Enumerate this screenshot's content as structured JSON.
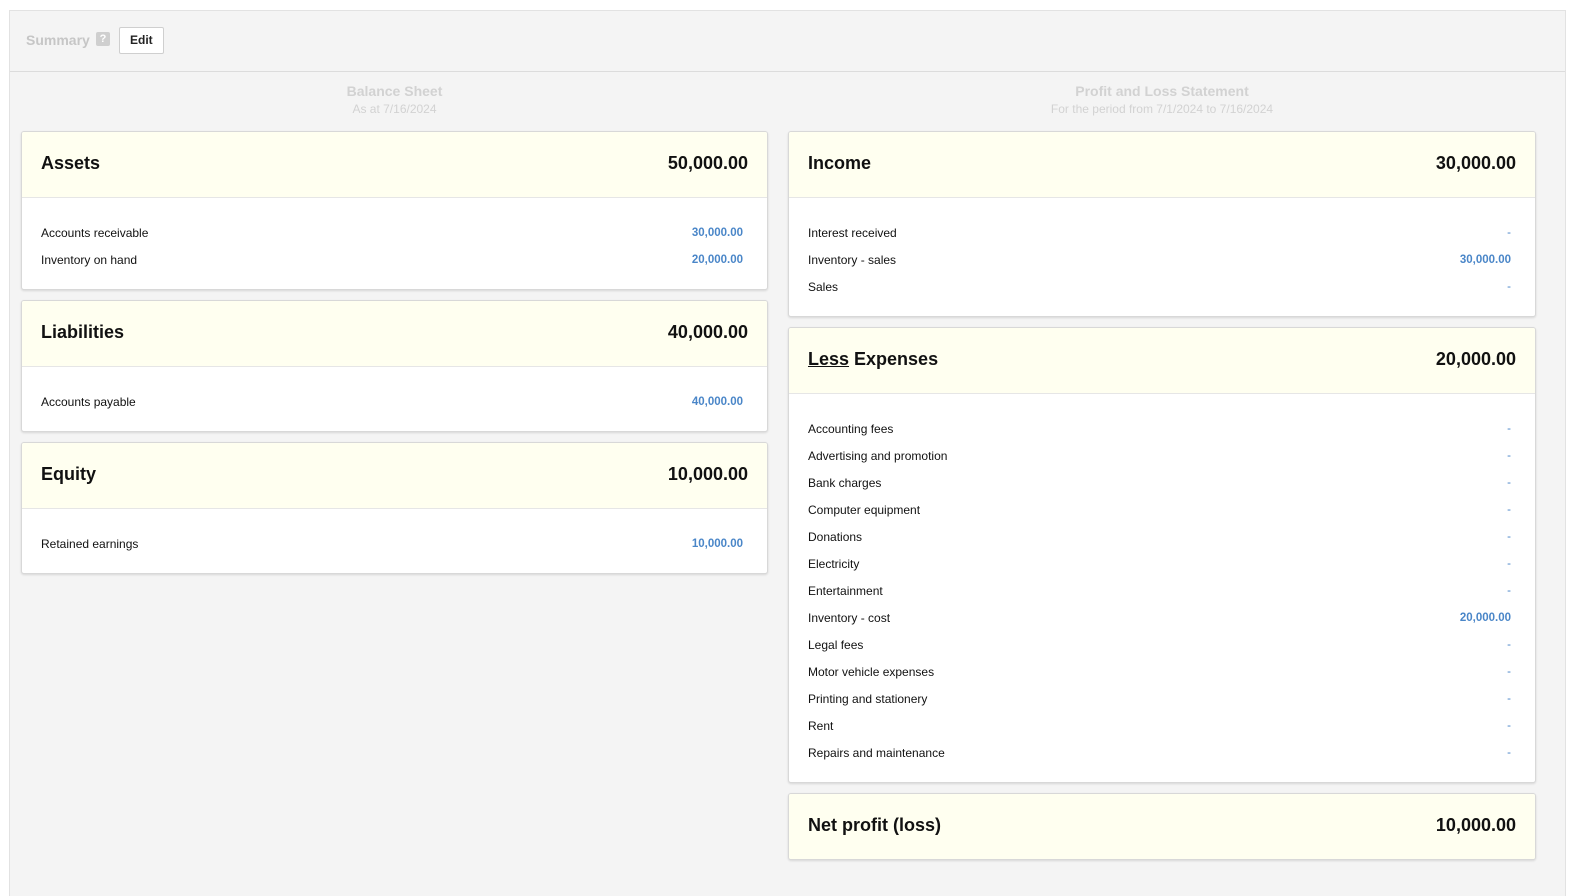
{
  "header": {
    "title": "Summary",
    "help_glyph": "?",
    "edit_label": "Edit"
  },
  "balance_sheet": {
    "title": "Balance Sheet",
    "subtitle": "As at 7/16/2024",
    "sections": [
      {
        "title": "Assets",
        "total": "50,000.00",
        "rows": [
          {
            "label": "Accounts receivable",
            "value": "30,000.00"
          },
          {
            "label": "Inventory on hand",
            "value": "20,000.00"
          }
        ]
      },
      {
        "title": "Liabilities",
        "total": "40,000.00",
        "rows": [
          {
            "label": "Accounts payable",
            "value": "40,000.00"
          }
        ]
      },
      {
        "title": "Equity",
        "total": "10,000.00",
        "rows": [
          {
            "label": "Retained earnings",
            "value": "10,000.00"
          }
        ]
      }
    ]
  },
  "profit_loss": {
    "title": "Profit and Loss Statement",
    "subtitle": "For the period from 7/1/2024 to 7/16/2024",
    "income": {
      "title": "Income",
      "total": "30,000.00",
      "rows": [
        {
          "label": "Interest received",
          "value": "-"
        },
        {
          "label": "Inventory - sales",
          "value": "30,000.00"
        },
        {
          "label": "Sales",
          "value": "-"
        }
      ]
    },
    "expenses": {
      "title_prefix": "Less",
      "title_suffix": " Expenses",
      "total": "20,000.00",
      "rows": [
        {
          "label": "Accounting fees",
          "value": "-"
        },
        {
          "label": "Advertising and promotion",
          "value": "-"
        },
        {
          "label": "Bank charges",
          "value": "-"
        },
        {
          "label": "Computer equipment",
          "value": "-"
        },
        {
          "label": "Donations",
          "value": "-"
        },
        {
          "label": "Electricity",
          "value": "-"
        },
        {
          "label": "Entertainment",
          "value": "-"
        },
        {
          "label": "Inventory - cost",
          "value": "20,000.00"
        },
        {
          "label": "Legal fees",
          "value": "-"
        },
        {
          "label": "Motor vehicle expenses",
          "value": "-"
        },
        {
          "label": "Printing and stationery",
          "value": "-"
        },
        {
          "label": "Rent",
          "value": "-"
        },
        {
          "label": "Repairs and maintenance",
          "value": "-"
        }
      ]
    },
    "net": {
      "title": "Net profit (loss)",
      "total": "10,000.00"
    }
  },
  "colors": {
    "accent_link": "#4a86c8",
    "section_header_bg": "#fffff0",
    "page_bg": "#f4f4f4"
  }
}
